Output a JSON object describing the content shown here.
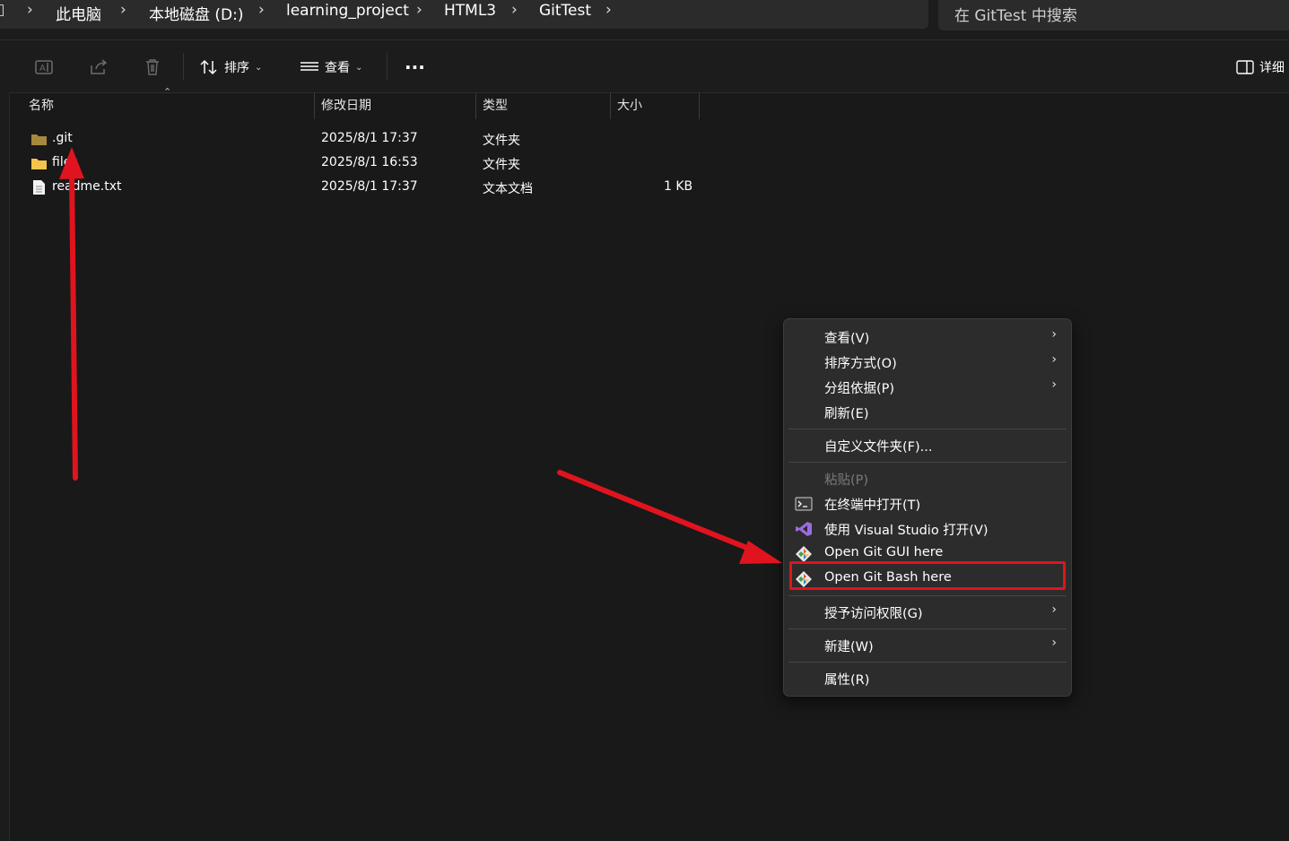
{
  "breadcrumb": {
    "items": [
      "此电脑",
      "本地磁盘 (D:)",
      "learning_project",
      "HTML3",
      "GitTest"
    ]
  },
  "search": {
    "placeholder": "在 GitTest 中搜索"
  },
  "toolbar": {
    "sort_label": "排序",
    "view_label": "查看",
    "details_label": "详细"
  },
  "columns": {
    "name": "名称",
    "date": "修改日期",
    "type": "类型",
    "size": "大小"
  },
  "files": [
    {
      "name": ".git",
      "date": "2025/8/1 17:37",
      "type": "文件夹",
      "size": "",
      "icon": "folder-icon-dim"
    },
    {
      "name": "files",
      "date": "2025/8/1 16:53",
      "type": "文件夹",
      "size": "",
      "icon": "folder-icon"
    },
    {
      "name": "readme.txt",
      "date": "2025/8/1 17:37",
      "type": "文本文档",
      "size": "1 KB",
      "icon": "text-file-icon"
    }
  ],
  "context_menu": {
    "view": "查看(V)",
    "sort_by": "排序方式(O)",
    "group_by": "分组依据(P)",
    "refresh": "刷新(E)",
    "customize": "自定义文件夹(F)...",
    "paste": "粘贴(P)",
    "open_terminal": "在终端中打开(T)",
    "open_vs": "使用 Visual Studio 打开(V)",
    "git_gui": "Open Git GUI here",
    "git_bash": "Open Git Bash here",
    "grant_access": "授予访问权限(G)",
    "new": "新建(W)",
    "properties": "属性(R)"
  },
  "colors": {
    "background": "#191919",
    "menu_background": "#2c2c2c",
    "highlight_red": "#e0141e",
    "folder_yellow": "#f4c54a"
  }
}
